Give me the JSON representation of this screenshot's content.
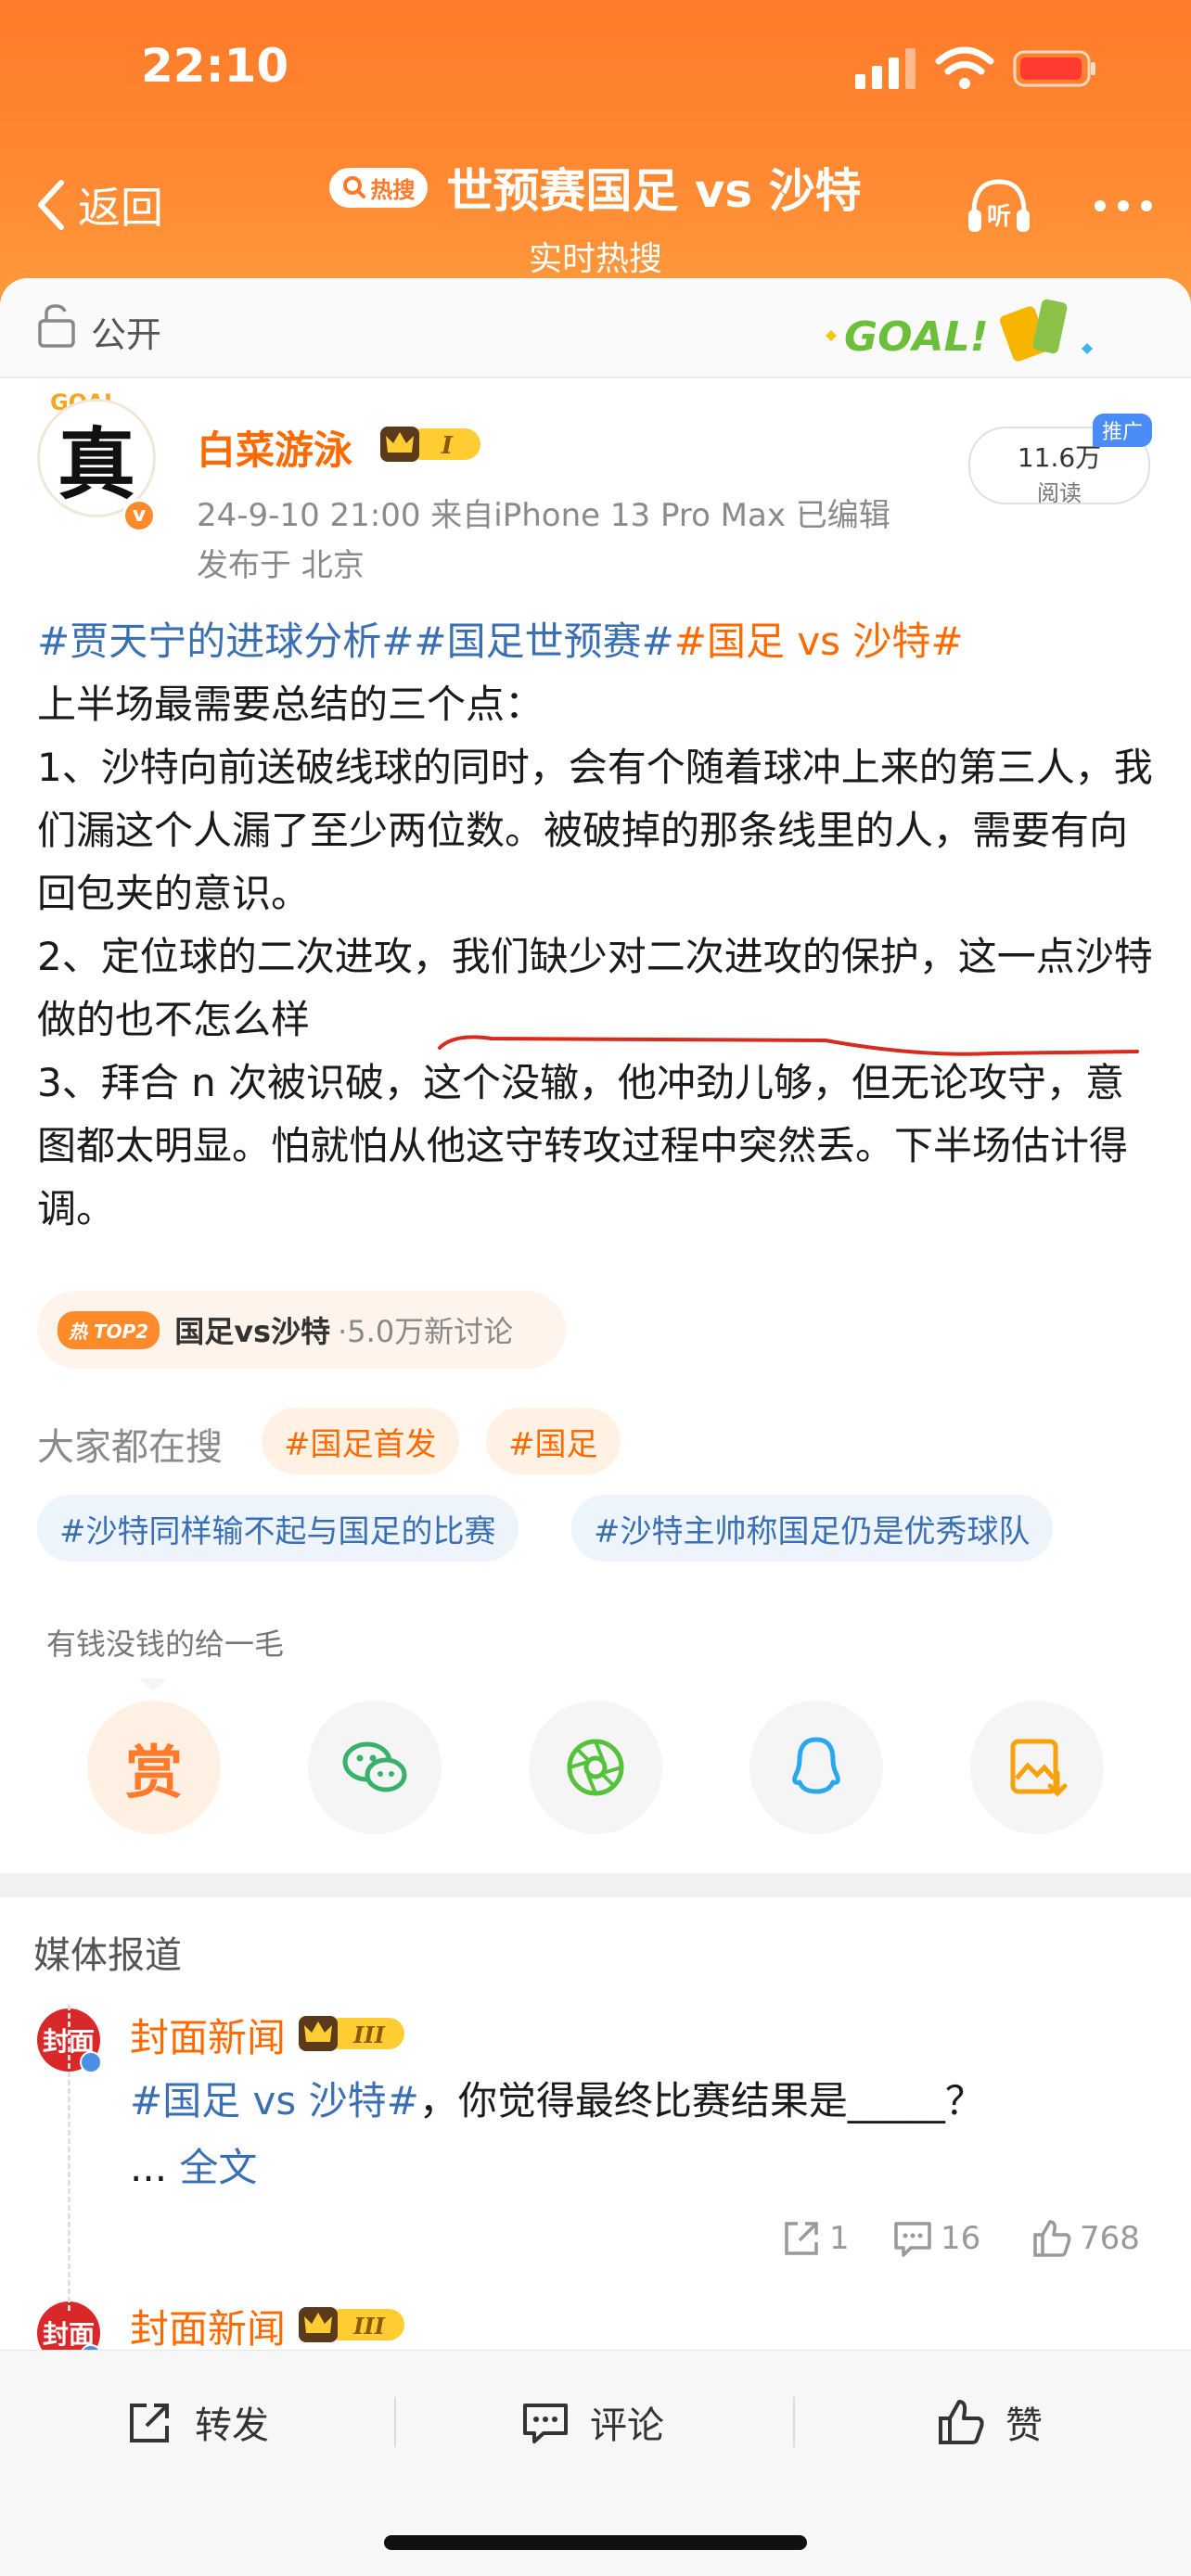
{
  "status": {
    "time": "22:10"
  },
  "nav": {
    "back_label": "返回",
    "hot_label": "热搜",
    "title": "世预赛国足 vs 沙特",
    "subtitle": "实时热搜"
  },
  "visibility": {
    "label": "公开",
    "banner_text": "GOAL!"
  },
  "author": {
    "name": "白菜游泳",
    "avatar_char": "真",
    "level_badge": "I",
    "meta": "24-9-10 21:00  来自iPhone 13 Pro Max  已编辑",
    "location": "发布于 北京",
    "reads": "11.6万",
    "reads_label": "阅读",
    "promo": "推广"
  },
  "post": {
    "tag1": "#贾天宁的进球分析#",
    "tag2": "#国足世预赛#",
    "tag3": "#国足 vs 沙特#",
    "line1": "上半场最需要总结的三个点：",
    "line2": "1、沙特向前送破线球的同时，会有个随着球冲上来的第三人，我们漏这个人漏了至少两位数。被破掉的那条线里的人，需要有向回包夹的意识。",
    "line3": "2、定位球的二次进攻，我们缺少对二次进攻的保护，这一点沙特做的也不怎么样",
    "line4a": "3、拜合 n 次被识破，这个没辙，他冲劲儿够，但无论攻守，意图都太明显。",
    "line4b": "怕就怕从他这守转攻过程中突然丢。",
    "line4c": "下半场估计得调。"
  },
  "topic": {
    "badge": "TOP2",
    "badge_char": "热",
    "name": "国足vs沙特",
    "discussion": "·5.0万新讨论"
  },
  "searching": {
    "label": "大家都在搜",
    "chips": [
      "#国足首发",
      "#国足",
      "#沙特同样输不起与国足的比赛",
      "#沙特主帅称国足仍是优秀球队"
    ]
  },
  "reward": {
    "text": "有钱没钱的给一毛",
    "button": "赏"
  },
  "share_icons": [
    "wechat-icon",
    "moments-icon",
    "qq-icon",
    "save-image-icon"
  ],
  "media": {
    "section_title": "媒体报道",
    "source_name": "封面新闻",
    "source_avatar": "封面",
    "level_badge": "III",
    "tag": "#国足 vs 沙特#",
    "text": "，你觉得最终比赛结果是_____？",
    "ellipsis": "...",
    "full_link": "全文",
    "reposts": "1",
    "comments": "16",
    "likes": "768",
    "second_source_name": "封面新闻"
  },
  "bottom_bar": {
    "repost": "转发",
    "comment": "评论",
    "like": "赞"
  },
  "colors": {
    "brand_orange": "#ff7a2a",
    "tag_blue": "#3a6fb3",
    "name_orange": "#ff6a00"
  }
}
